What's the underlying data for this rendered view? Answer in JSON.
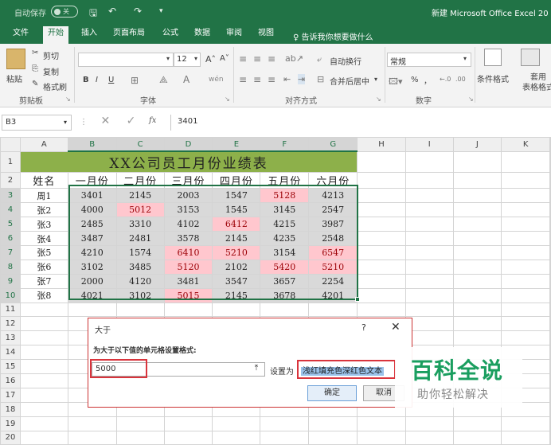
{
  "titlebar": {
    "autosave": "自动保存",
    "toggle": "关",
    "save": "🖫",
    "undo": "↶",
    "redo": "↷",
    "doc_title": "新建 Microsoft Office Excel 20"
  },
  "tabs": [
    {
      "label": "文件"
    },
    {
      "label": "开始",
      "active": true
    },
    {
      "label": "插入"
    },
    {
      "label": "页面布局"
    },
    {
      "label": "公式"
    },
    {
      "label": "数据"
    },
    {
      "label": "审阅"
    },
    {
      "label": "视图"
    }
  ],
  "tell_me": "告诉我你想要做什么",
  "ribbon": {
    "paste": "粘贴",
    "cut": "剪切",
    "copy": "复制",
    "format_painter": "格式刷",
    "clipboard": "剪贴板",
    "font_size": "12",
    "bold": "B",
    "italic": "I",
    "underline": "U",
    "font_group": "字体",
    "wrap": "自动换行",
    "merge": "合并后居中",
    "align_group": "对齐方式",
    "number_format": "常规",
    "percent": "%",
    "comma": "，",
    "number_group": "数字",
    "cond_format": "条件格式",
    "table_format": "套用\n表格格式"
  },
  "formula_bar": {
    "name_box": "B3",
    "fx": "fx",
    "content": "3401"
  },
  "grid": {
    "columns": [
      "A",
      "B",
      "C",
      "D",
      "E",
      "F",
      "G",
      "H",
      "I",
      "J",
      "K"
    ],
    "title": "XX公司员工月份业绩表",
    "headers": [
      "姓名",
      "一月份",
      "二月份",
      "三月份",
      "四月份",
      "五月份",
      "六月份"
    ],
    "rows": [
      [
        "周1",
        "3401",
        "2145",
        "2003",
        "1547",
        "5128",
        "4213"
      ],
      [
        "张2",
        "4000",
        "5012",
        "3153",
        "1545",
        "3145",
        "2547"
      ],
      [
        "张3",
        "2485",
        "3310",
        "4102",
        "6412",
        "4215",
        "3987"
      ],
      [
        "张4",
        "3487",
        "2481",
        "3578",
        "2145",
        "4235",
        "2548"
      ],
      [
        "张5",
        "4210",
        "1574",
        "6410",
        "5210",
        "3154",
        "6547"
      ],
      [
        "张6",
        "3102",
        "3485",
        "5120",
        "2102",
        "5420",
        "5210"
      ],
      [
        "张7",
        "2000",
        "4120",
        "3481",
        "3547",
        "3657",
        "2254"
      ],
      [
        "张8",
        "4021",
        "3102",
        "5015",
        "2145",
        "3678",
        "4201"
      ]
    ],
    "highlight_threshold": 5000,
    "colors": {
      "title_bg": "#8db04a",
      "data_bg": "#d9d9d9",
      "highlight_bg": "#ffc7ce",
      "highlight_text": "#9c0006"
    }
  },
  "dialog": {
    "title": "大于",
    "help": "?",
    "close": "✕",
    "prompt": "为大于以下值的单元格设置格式:",
    "value": "5000",
    "set_label": "设置为",
    "format_option": "浅红填充色深红色文本",
    "ok": "确定",
    "cancel": "取消"
  },
  "watermark": {
    "brand": "百科全说",
    "slogan": "助你轻松解决"
  }
}
